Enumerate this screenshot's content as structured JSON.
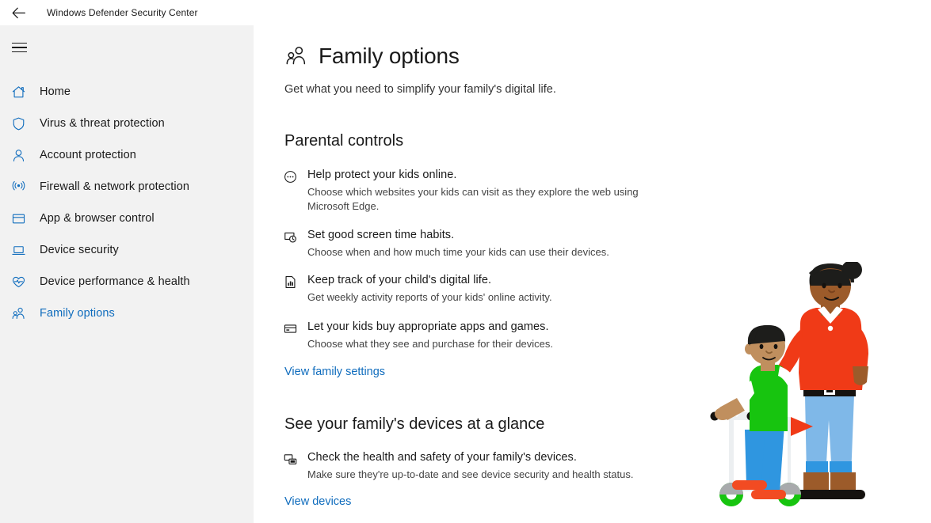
{
  "window": {
    "title": "Windows Defender Security Center",
    "back_icon": "back-arrow-icon",
    "menu_icon": "hamburger-menu-icon"
  },
  "sidebar": {
    "items": [
      {
        "label": "Home",
        "icon": "home-icon",
        "active": false
      },
      {
        "label": "Virus & threat protection",
        "icon": "shield-icon",
        "active": false
      },
      {
        "label": "Account protection",
        "icon": "person-icon",
        "active": false
      },
      {
        "label": "Firewall & network protection",
        "icon": "wifi-signal-icon",
        "active": false
      },
      {
        "label": "App & browser control",
        "icon": "browser-window-icon",
        "active": false
      },
      {
        "label": "Device security",
        "icon": "laptop-icon",
        "active": false
      },
      {
        "label": "Device performance & health",
        "icon": "heart-pulse-icon",
        "active": false
      },
      {
        "label": "Family options",
        "icon": "family-people-icon",
        "active": true
      }
    ]
  },
  "main": {
    "page_icon": "family-people-icon",
    "title": "Family options",
    "subtitle": "Get what you need to simplify your family's digital life.",
    "sections": [
      {
        "heading": "Parental controls",
        "features": [
          {
            "icon": "web-dots-circle-icon",
            "heading": "Help protect your kids online.",
            "description": "Choose which websites your kids can visit as they explore the web using Microsoft Edge."
          },
          {
            "icon": "screen-time-clock-icon",
            "heading": "Set good screen time habits.",
            "description": "Choose when and how much time your kids can use their devices."
          },
          {
            "icon": "activity-report-icon",
            "heading": "Keep track of your child's digital life.",
            "description": "Get weekly activity reports of your kids' online activity."
          },
          {
            "icon": "credit-card-icon",
            "heading": "Let your kids buy appropriate apps and games.",
            "description": "Choose what they see and purchase for their devices."
          }
        ],
        "link": "View family settings"
      },
      {
        "heading": "See your family's devices at a glance",
        "features": [
          {
            "icon": "devices-icon",
            "heading": "Check the health and safety of your family's devices.",
            "description": "Make sure they're up-to-date and see device security and health status."
          }
        ],
        "link": "View devices"
      }
    ]
  },
  "illustration": {
    "name": "family-parent-and-child-on-scooter-illustration",
    "colors": {
      "adult_shirt": "#f03a17",
      "adult_pants": "#7fb8e8",
      "adult_pants_cuff": "#2f96e0",
      "adult_skin": "#9c5b2a",
      "adult_hair": "#1d1d1b",
      "adult_shoes": "#15120f",
      "adult_belt": "#15120f",
      "child_shirt": "#17c40f",
      "child_sleeve": "#ffffff",
      "child_pants": "#2f96e0",
      "child_skin": "#c08f5e",
      "child_hair": "#1d1d1b",
      "child_shoes": "#f24b22",
      "scooter_body": "#eceff1",
      "scooter_wheel": "#17c40f",
      "scooter_fender": "#a8aaac",
      "flag": "#f03a17"
    }
  },
  "theme": {
    "accent": "#0f6cbd",
    "sidebar_bg": "#f2f2f2",
    "content_bg": "#ffffff",
    "text_primary": "#1a1a1a",
    "text_secondary": "#444444"
  }
}
